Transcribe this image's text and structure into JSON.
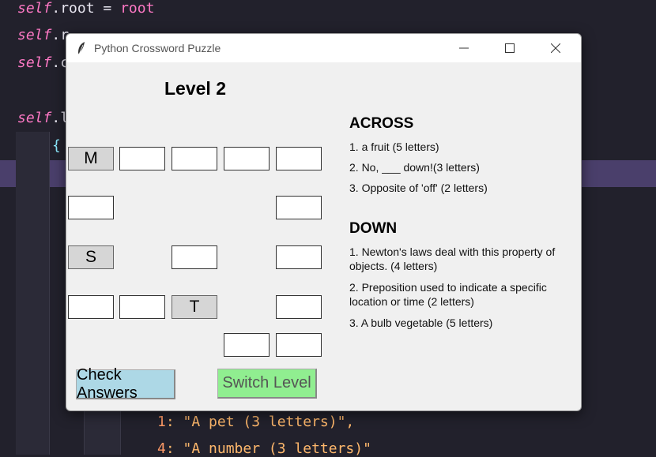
{
  "editor": {
    "lines": [
      {
        "self": "self",
        "rest": ".root = ",
        "tail": "root"
      },
      {
        "self": "self",
        "rest": ".r",
        "tail": ""
      },
      {
        "self": "self",
        "rest": ".c",
        "tail": ""
      },
      {
        "self": "self",
        "rest": ".l",
        "tail": ""
      }
    ],
    "brace": "{",
    "bottom_lines": [
      {
        "key": "1",
        "text": ": \"A pet (3 letters)\","
      },
      {
        "key": "4",
        "text": ": \"A number (3 letters)\""
      }
    ]
  },
  "window": {
    "title": "Python Crossword Puzzle",
    "controls": {
      "minimize": "—",
      "maximize": "☐",
      "close": "✕"
    }
  },
  "level_label": "Level 2",
  "grid": {
    "fixed_letters": {
      "m": "M",
      "s": "S",
      "t": "T"
    },
    "entries": {
      "r1c2": "",
      "r1c3": "",
      "r1c4": "",
      "r1c5": "",
      "r2c1": "",
      "r2c5": "",
      "r3c3": "",
      "r3c5": "",
      "r4c1": "",
      "r4c2": "",
      "r4c5": "",
      "r5c4": "",
      "r5c5": ""
    }
  },
  "clues": {
    "across_title": "ACROSS",
    "across": [
      "1. a fruit (5 letters)",
      "2.  No, ___ down!(3 letters)",
      "3. Opposite of 'off' (2 letters)"
    ],
    "down_title": "DOWN",
    "down": [
      "1. Newton's laws deal with this property of objects. (4 letters)",
      "2. Preposition used to indicate a specific location or time (2 letters)",
      "3. A bulb vegetable (5 letters)"
    ]
  },
  "buttons": {
    "check": "Check Answers",
    "switch": "Switch Level"
  },
  "colors": {
    "check_button": "#add8e6",
    "switch_button": "#90ee90",
    "fixed_cell": "#d6d6d6",
    "window_bg": "#f0f0f0"
  }
}
